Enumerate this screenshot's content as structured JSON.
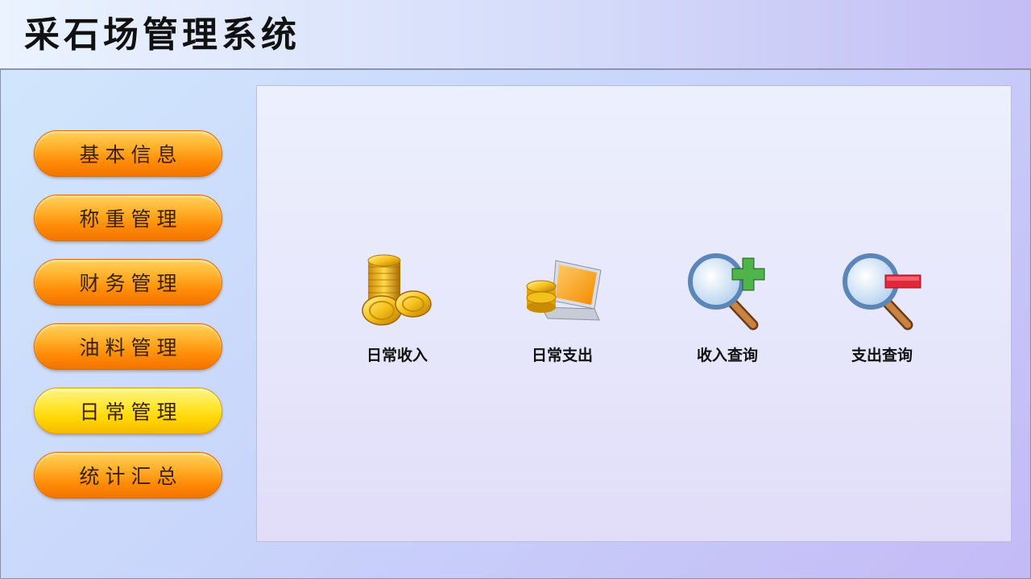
{
  "app": {
    "title": "采石场管理系统"
  },
  "sidebar": {
    "items": [
      {
        "label": "基本信息"
      },
      {
        "label": "称重管理"
      },
      {
        "label": "财务管理"
      },
      {
        "label": "油料管理"
      },
      {
        "label": "日常管理",
        "active": true
      },
      {
        "label": "统计汇总"
      }
    ]
  },
  "main": {
    "tiles": [
      {
        "label": "日常收入",
        "icon": "gold-coins-icon"
      },
      {
        "label": "日常支出",
        "icon": "laptop-coins-icon"
      },
      {
        "label": "收入查询",
        "icon": "magnifier-plus-icon"
      },
      {
        "label": "支出查询",
        "icon": "magnifier-minus-icon"
      }
    ]
  },
  "colors": {
    "button_orange": "#ff9a10",
    "button_active_yellow": "#ffe83a",
    "plus_green": "#3e9a3a",
    "minus_red": "#e0283a"
  }
}
